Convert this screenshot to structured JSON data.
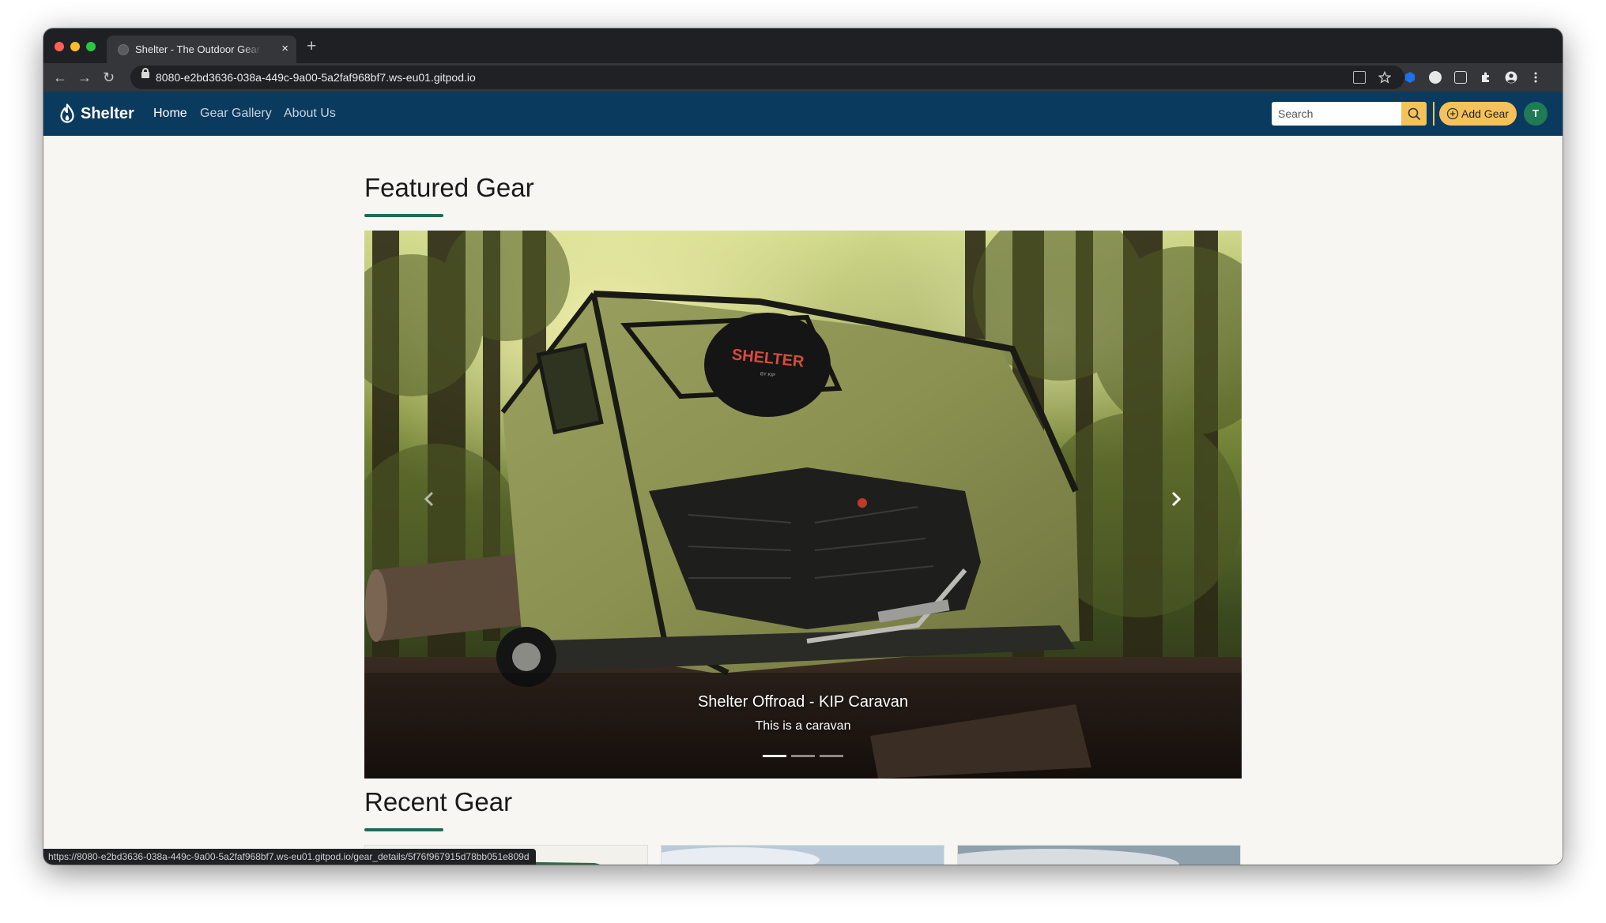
{
  "browser": {
    "tab_title": "Shelter - The Outdoor Gear Co",
    "tab_close_glyph": "×",
    "new_tab_glyph": "+",
    "url": "8080-e2bd3636-038a-449c-9a00-5a2faf968bf7.ws-eu01.gitpod.io",
    "nav_glyphs": {
      "back": "←",
      "forward": "→",
      "reload": "↻"
    },
    "status_url": "https://8080-e2bd3636-038a-449c-9a00-5a2faf968bf7.ws-eu01.gitpod.io/gear_details/5f76f967915d78bb051e809d"
  },
  "navbar": {
    "brand": "Shelter",
    "links": [
      {
        "label": "Home",
        "active": true
      },
      {
        "label": "Gear Gallery",
        "active": false
      },
      {
        "label": "About Us",
        "active": false
      }
    ],
    "search_placeholder": "Search",
    "add_gear_label": "Add Gear",
    "avatar_initial": "T",
    "colors": {
      "navbar_bg": "#0b3a5f",
      "accent": "#f5c25a",
      "avatar_bg": "#1f7a55"
    }
  },
  "featured": {
    "heading": "Featured Gear",
    "slides": [
      {
        "title": "Shelter Offroad - KIP Caravan",
        "caption": "This is a caravan",
        "active": true
      },
      {
        "active": false
      },
      {
        "active": false
      }
    ],
    "prev_icon": "chevron-left-icon",
    "next_icon": "chevron-right-icon",
    "camper_logo_text": "SHELTER",
    "camper_logo_sub": "BY KIP"
  },
  "recent": {
    "heading": "Recent Gear"
  },
  "colors": {
    "section_underline": "#1f6b58",
    "page_bg": "#f7f6f2"
  }
}
